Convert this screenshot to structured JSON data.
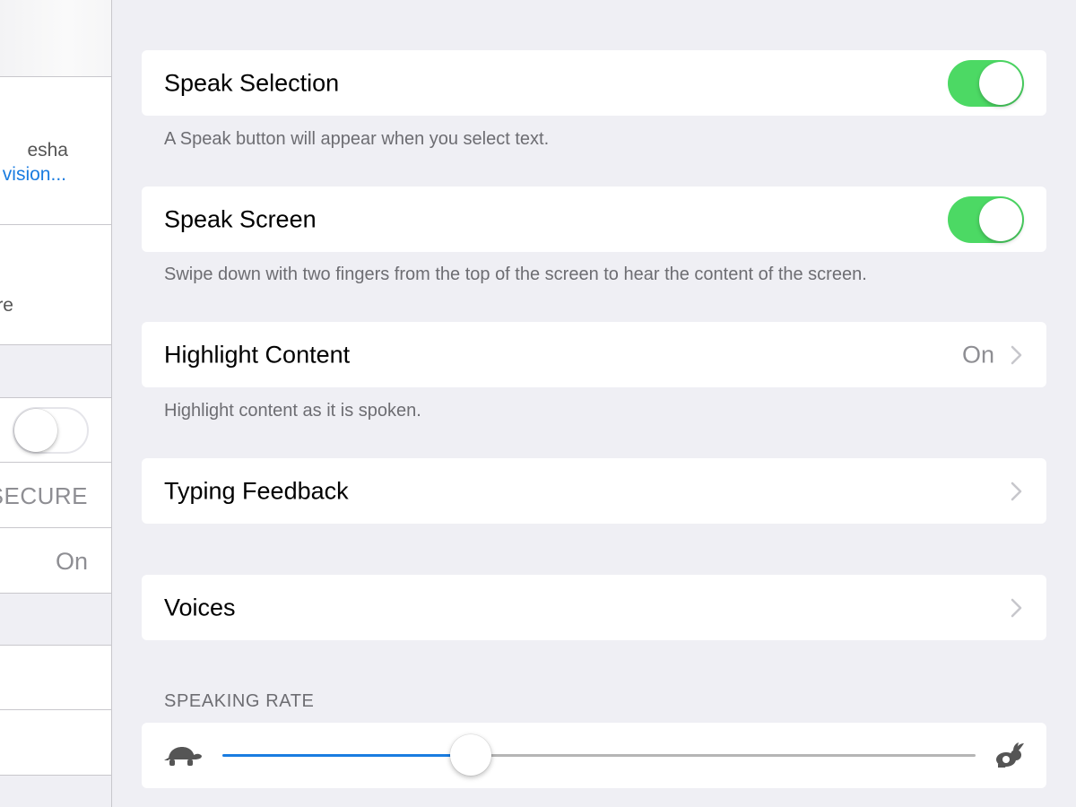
{
  "master": {
    "profile_name_fragment": "esha",
    "profile_link_fragment": "vision...",
    "notice_fragment": "re",
    "section_label_fragment": "SECURE",
    "row_value": "On"
  },
  "detail": {
    "speak_selection": {
      "label": "Speak Selection",
      "enabled": true,
      "footer": "A Speak button will appear when you select text."
    },
    "speak_screen": {
      "label": "Speak Screen",
      "enabled": true,
      "footer": "Swipe down with two fingers from the top of the screen to hear the content of the screen."
    },
    "highlight_content": {
      "label": "Highlight Content",
      "value": "On",
      "footer": "Highlight content as it is spoken."
    },
    "typing_feedback": {
      "label": "Typing Feedback"
    },
    "voices": {
      "label": "Voices"
    },
    "speaking_rate": {
      "header": "SPEAKING RATE",
      "value": 0.33,
      "min_icon": "turtle-icon",
      "max_icon": "hare-icon"
    }
  },
  "colors": {
    "toggle_on": "#4cd964",
    "accent": "#1a7ce0",
    "background": "#efeff4"
  }
}
